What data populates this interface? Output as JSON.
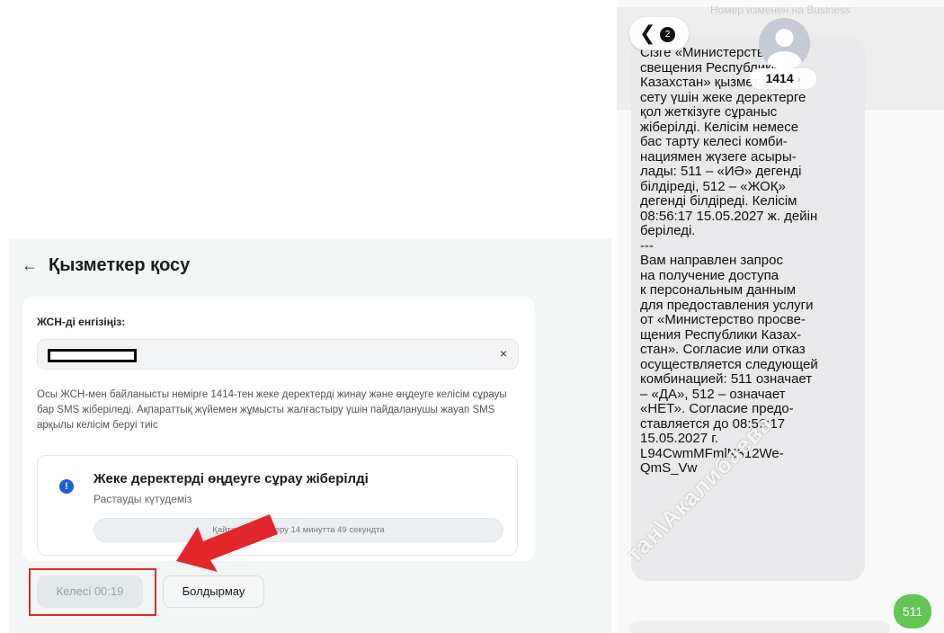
{
  "form": {
    "title": "Қызметкер қосу",
    "field_label": "ЖСН-ді енгізіңіз:",
    "info_text": "Осы ЖСН-мен байланысты нөмірге 1414-тен жеке деректерді жинау және өңдеуге келісім сұрауы бар SMS жіберіледі. Ақпараттық жүйемен жұмысты жалғастыру үшін пайдаланушы жауап SMS арқылы келісім беруі тиіс",
    "status_title": "Жеке деректерді өңдеуге сұрау жіберілді",
    "status_subtitle": "Растауды күтудеміз",
    "resend_text": "Қайта сұрау жіберу 14 минутта 49 секундта",
    "next_button": "Келесі 00:19",
    "cancel_button": "Болдырмау",
    "clear_symbol": "×",
    "status_icon_symbol": "!",
    "back_symbol": "←"
  },
  "phone": {
    "top_faint_text": "Номер изменен на Business",
    "back_badge": "2",
    "back_symbol": "❮",
    "contact_name": "1414",
    "contact_chevron": "›",
    "sms_text": "Сізге «Министерство про-\nсвещения Республики\nКазахстан» қызмет көр-\nсету үшін жеке деректерге\nқол жеткізуге сұраныс\nжіберілді. Келісім немесе\nбас тарту келесі комби-\nнациямен жүзеге асыры-\nлады: 511 – «ИӘ» дегенді\nбілдіреді, 512 – «ЖОҚ»\nдегенді білдіреді. Келісім\n08:56:17 15.05.2027 ж. дейін\nберіледі.\n---\nВам направлен запрос\nна получение доступа\nк персональным данным\nдля предоставления услуги\nот «Министерство просве-\nщения Республики Казах-\nстан». Согласие или отказ\nосуществляется следующей\nкомбинацией: 511 означает\n– «ДА», 512 – означает\n«НЕТ». Согласие предо-\nставляется до 08:56:17\n15.05.2027 г.\nL94CwmMFmlN312We-\nQmS_Vw",
    "reply_text": "511"
  },
  "watermark_text": "тан\\Акалибаева",
  "colors": {
    "accent_red": "#e2262b",
    "info_blue": "#1c5fd6",
    "sms_green": "#62c554",
    "panel_bg": "#f2f7f6"
  }
}
